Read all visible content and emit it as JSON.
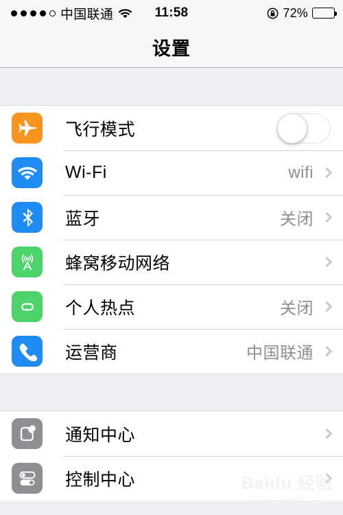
{
  "status_bar": {
    "signal_dots_filled": 4,
    "signal_dots_total": 5,
    "carrier": "中国联通",
    "wifi_icon": "wifi-icon",
    "time": "11:58",
    "rotation_lock_icon": "rotation-lock-icon",
    "battery_percent": "72%",
    "battery_level": 72
  },
  "navbar": {
    "title": "设置"
  },
  "groups": [
    {
      "rows": [
        {
          "icon": "airplane-icon",
          "icon_color": "#f79520",
          "label": "飞行模式",
          "accessory": "toggle",
          "toggle_on": false
        },
        {
          "icon": "wifi-icon",
          "icon_color": "#1f8cf5",
          "label": "Wi-Fi",
          "accessory": "chevron",
          "value": "wifi"
        },
        {
          "icon": "bluetooth-icon",
          "icon_color": "#1f8cf5",
          "label": "蓝牙",
          "accessory": "chevron",
          "value": "关闭"
        },
        {
          "icon": "cellular-tower-icon",
          "icon_color": "#4cd369",
          "label": "蜂窝移动网络",
          "accessory": "chevron",
          "value": ""
        },
        {
          "icon": "personal-hotspot-icon",
          "icon_color": "#4cd369",
          "label": "个人热点",
          "accessory": "chevron",
          "value": "关闭"
        },
        {
          "icon": "phone-handset-icon",
          "icon_color": "#1f8cf5",
          "label": "运营商",
          "accessory": "chevron",
          "value": "中国联通"
        }
      ]
    },
    {
      "rows": [
        {
          "icon": "notification-center-icon",
          "icon_color": "#8e8e93",
          "label": "通知中心",
          "accessory": "chevron",
          "value": ""
        },
        {
          "icon": "control-center-icon",
          "icon_color": "#8e8e93",
          "label": "控制中心",
          "accessory": "chevron",
          "value": ""
        }
      ]
    }
  ],
  "watermark": {
    "main": "Baidu 经验",
    "sub": "jingyan.baidu.com"
  }
}
